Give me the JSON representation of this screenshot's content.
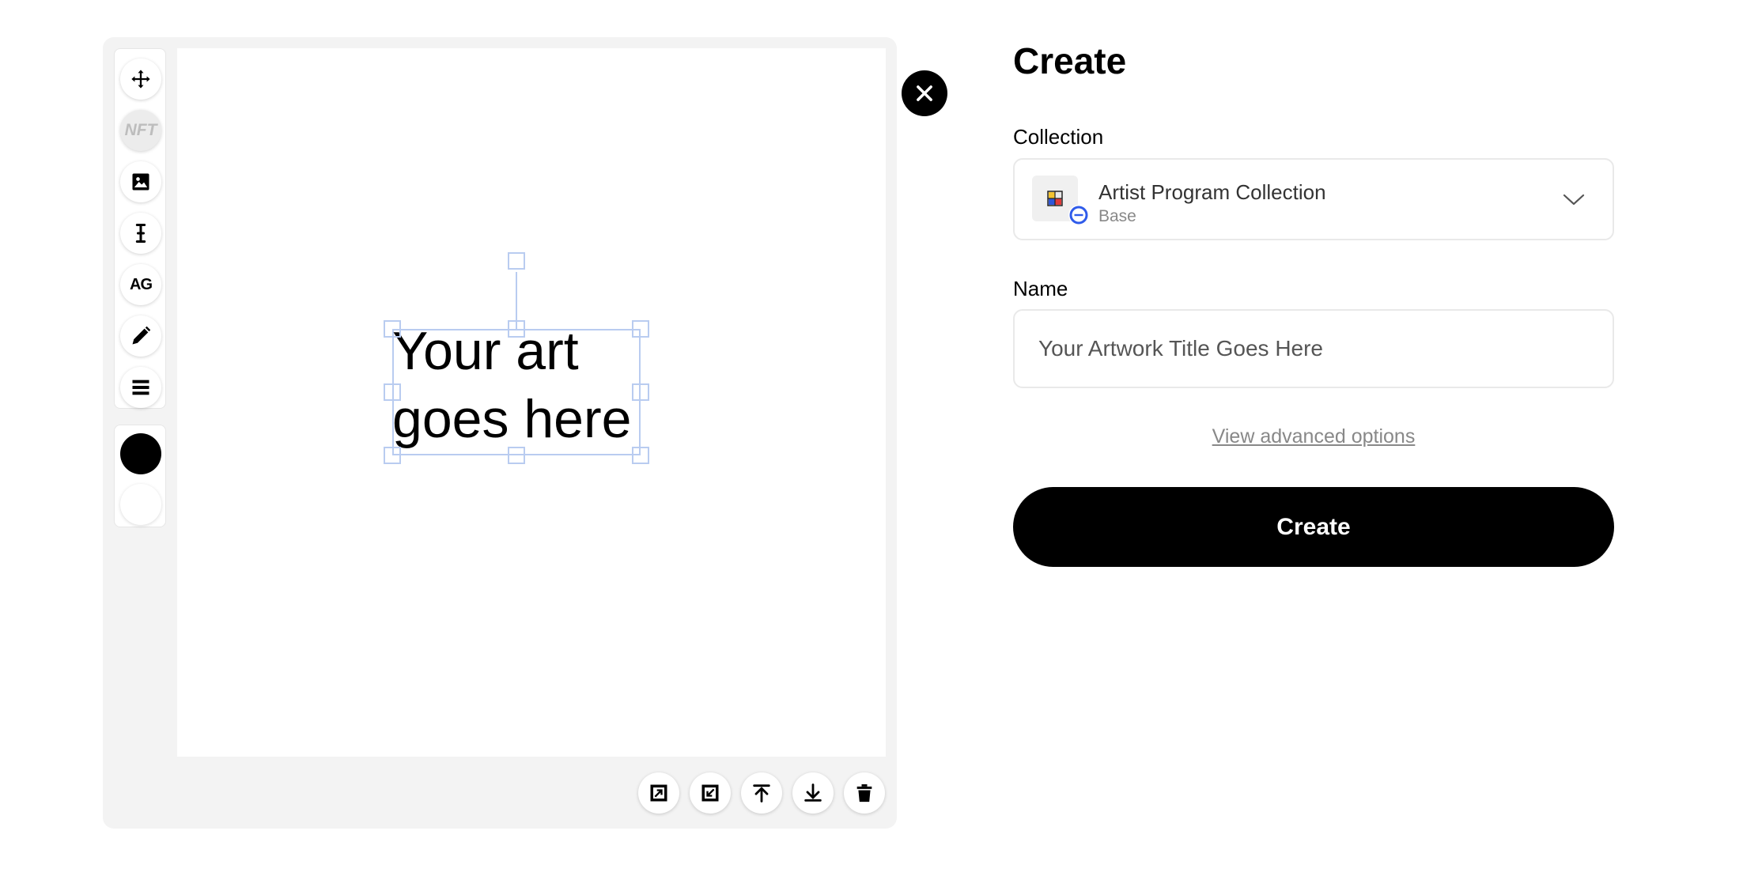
{
  "editor": {
    "tools": [
      {
        "name": "move-icon",
        "label": ""
      },
      {
        "name": "nft-icon",
        "label": "NFT"
      },
      {
        "name": "image-icon",
        "label": ""
      },
      {
        "name": "text-cursor-icon",
        "label": ""
      },
      {
        "name": "font-icon",
        "label": "AG"
      },
      {
        "name": "pencil-icon",
        "label": ""
      },
      {
        "name": "menu-icon",
        "label": ""
      }
    ],
    "colors": {
      "primary": "#000000",
      "secondary": "#ffffff"
    },
    "canvas_text_line1": "Your art",
    "canvas_text_line2": "goes here",
    "bottom_actions": [
      "bring-forward-icon",
      "send-backward-icon",
      "bring-to-front-icon",
      "send-to-back-icon",
      "trash-icon"
    ]
  },
  "form": {
    "title": "Create",
    "collection_label": "Collection",
    "collection": {
      "name": "Artist Program Collection",
      "chain": "Base"
    },
    "name_label": "Name",
    "name_placeholder": "Your Artwork Title Goes Here",
    "advanced_link": "View advanced options",
    "submit_label": "Create"
  }
}
